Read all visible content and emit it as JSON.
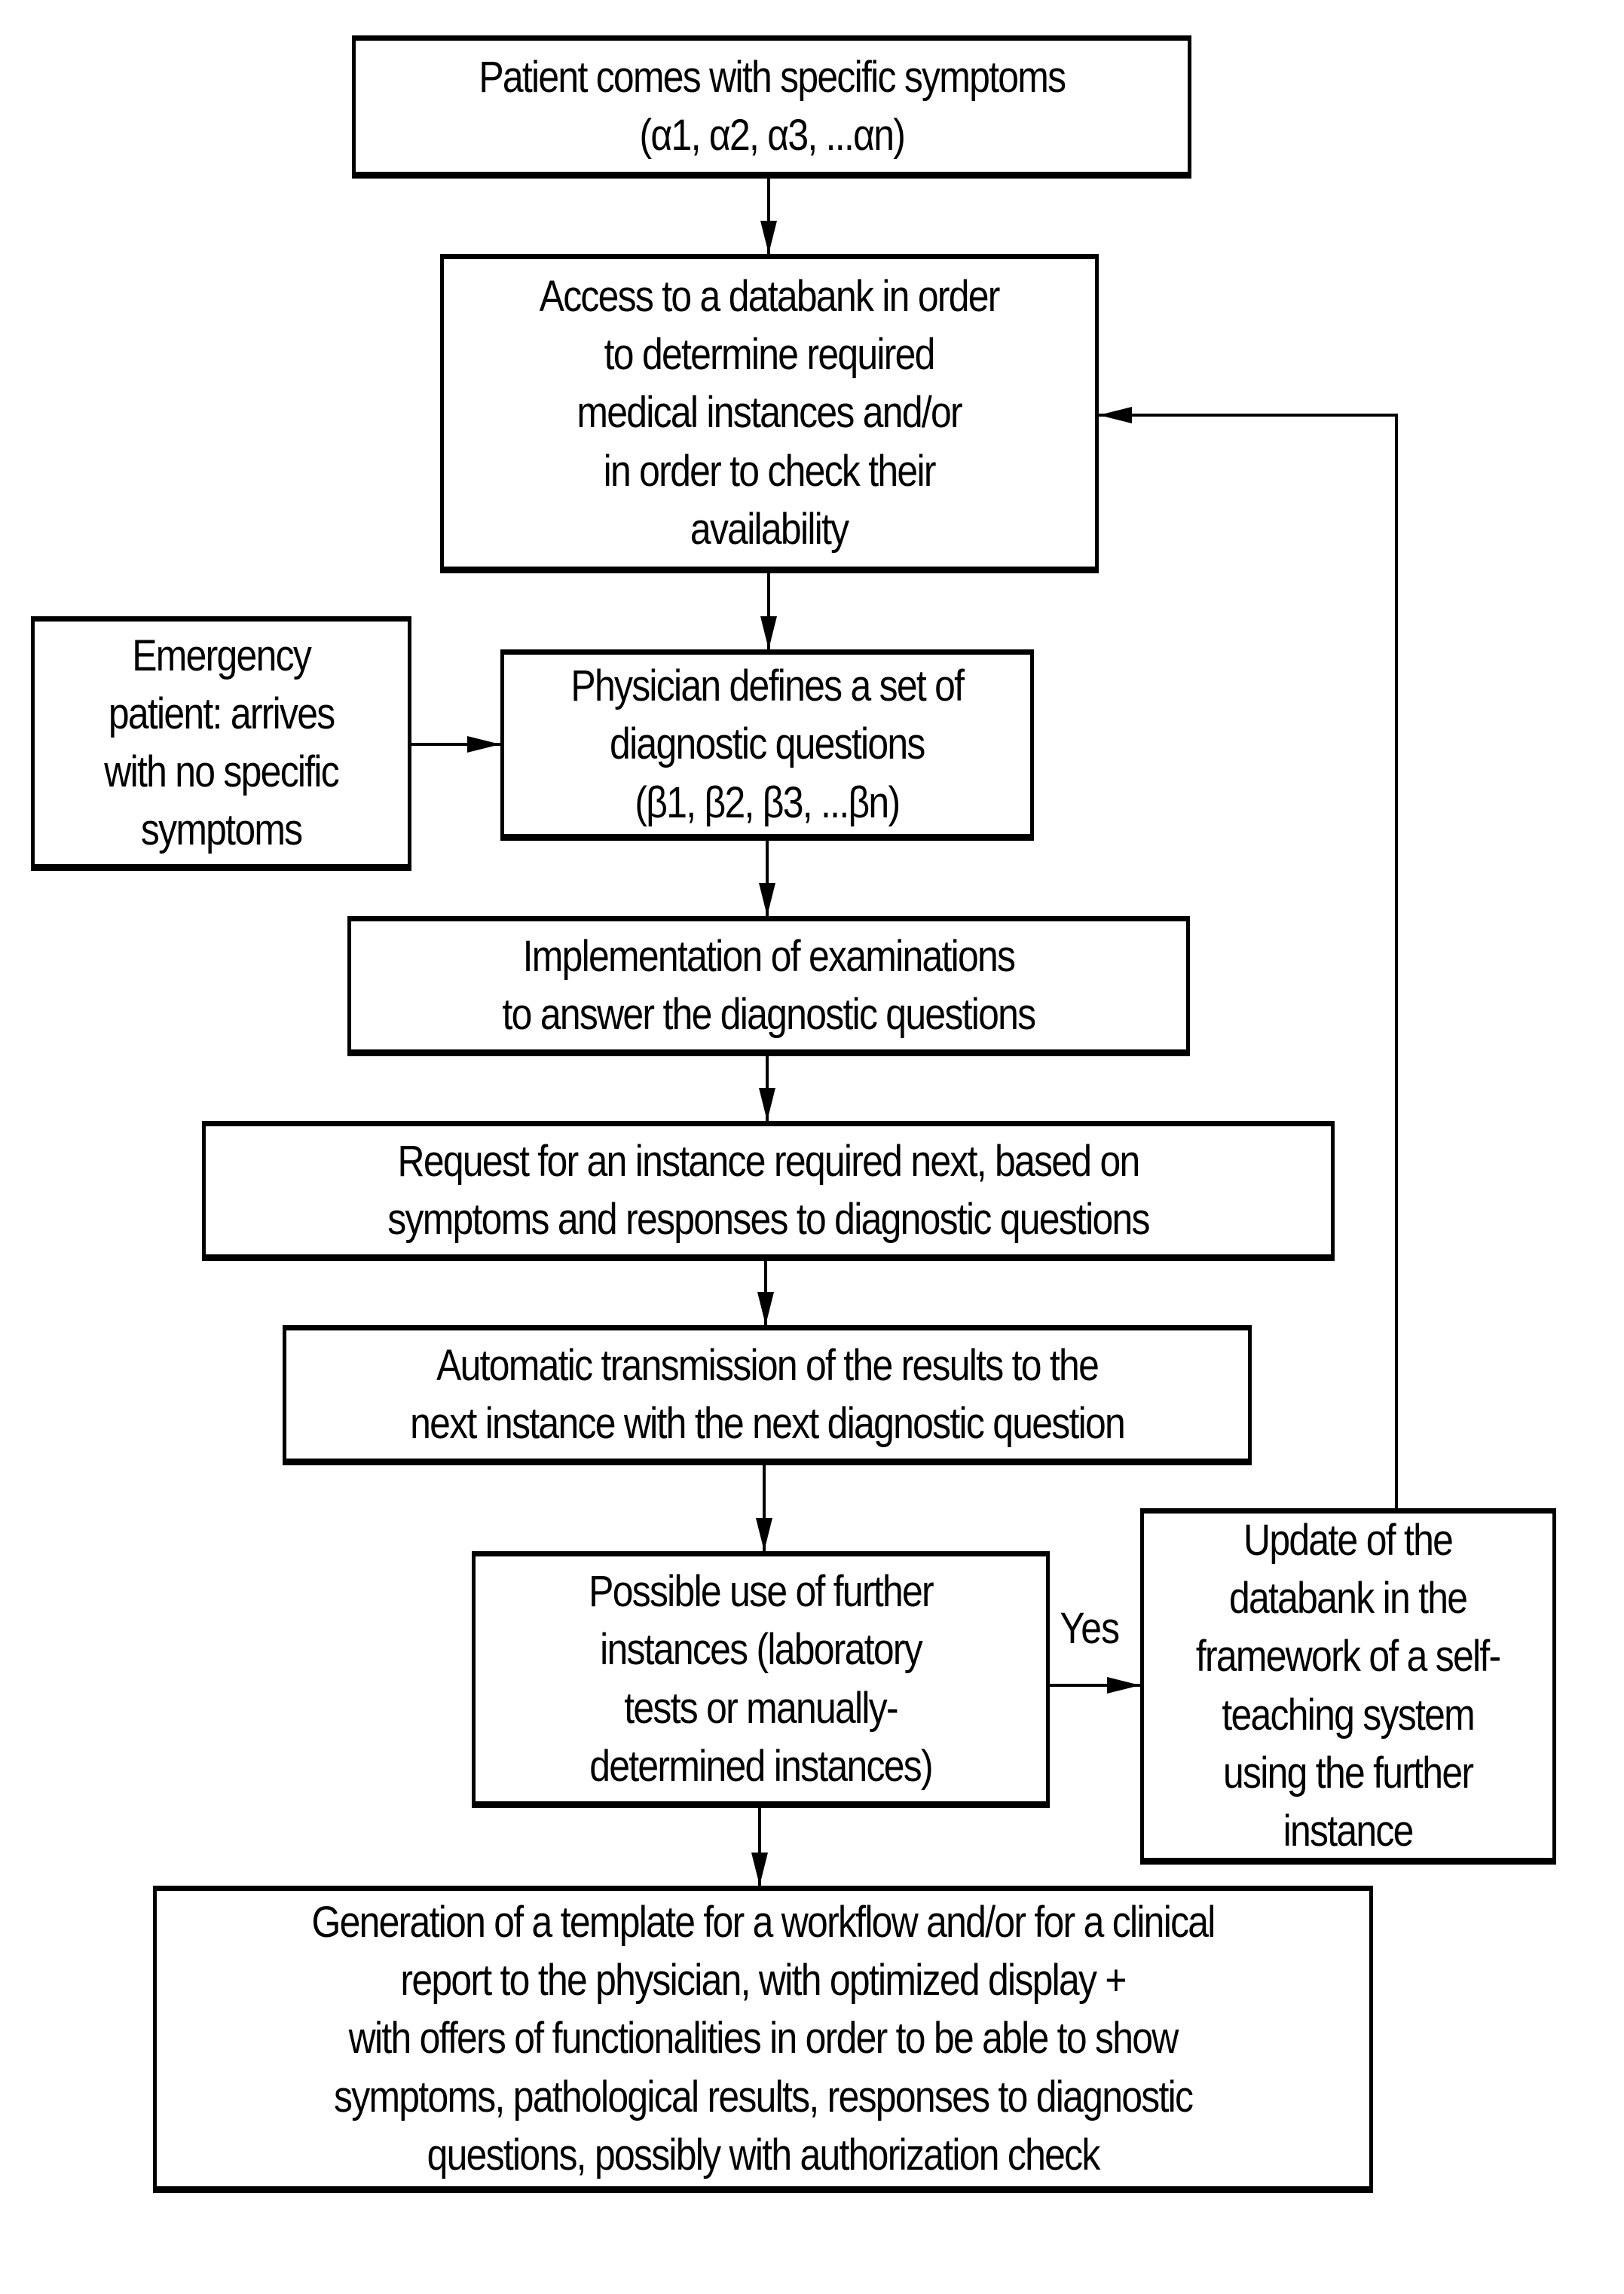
{
  "diagram": {
    "type": "flowchart",
    "nodes": [
      {
        "id": "patient",
        "text": "Patient comes with specific symptoms\n(α1, α2, α3, ...αn)"
      },
      {
        "id": "databank",
        "text": "Access to a databank in order\nto determine required\nmedical instances and/or\nin order to check their\navailability"
      },
      {
        "id": "emergency",
        "text": "Emergency\npatient: arrives\nwith no specific\nsymptoms"
      },
      {
        "id": "physician",
        "text": "Physician defines a set of\ndiagnostic questions\n(β1, β2, β3, ...βn)"
      },
      {
        "id": "implementation",
        "text": "Implementation of examinations\nto answer the diagnostic questions"
      },
      {
        "id": "request",
        "text": "Request for an instance required next, based on\nsymptoms and responses to diagnostic questions"
      },
      {
        "id": "transmission",
        "text": "Automatic transmission of the results to the\nnext instance with the next diagnostic question"
      },
      {
        "id": "further",
        "text": "Possible use of further\ninstances (laboratory\ntests or manually-\ndetermined instances)"
      },
      {
        "id": "update",
        "text": "Update of the\ndatabank in the\nframework of a self-\nteaching system\nusing the further\ninstance"
      },
      {
        "id": "generation",
        "text": "Generation of a template for a workflow and/or for a clinical\nreport to the physician, with optimized display +\nwith offers of functionalities in order to be able to show\nsymptoms, pathological results, responses to diagnostic\nquestions, possibly with authorization check"
      }
    ],
    "edges": [
      {
        "from": "patient",
        "to": "databank",
        "label": ""
      },
      {
        "from": "databank",
        "to": "physician",
        "label": ""
      },
      {
        "from": "emergency",
        "to": "physician",
        "label": ""
      },
      {
        "from": "physician",
        "to": "implementation",
        "label": ""
      },
      {
        "from": "implementation",
        "to": "request",
        "label": ""
      },
      {
        "from": "request",
        "to": "transmission",
        "label": ""
      },
      {
        "from": "transmission",
        "to": "further",
        "label": ""
      },
      {
        "from": "further",
        "to": "update",
        "label": "Yes"
      },
      {
        "from": "update",
        "to": "databank",
        "label": ""
      },
      {
        "from": "further",
        "to": "generation",
        "label": ""
      }
    ],
    "yes_label": "Yes"
  }
}
